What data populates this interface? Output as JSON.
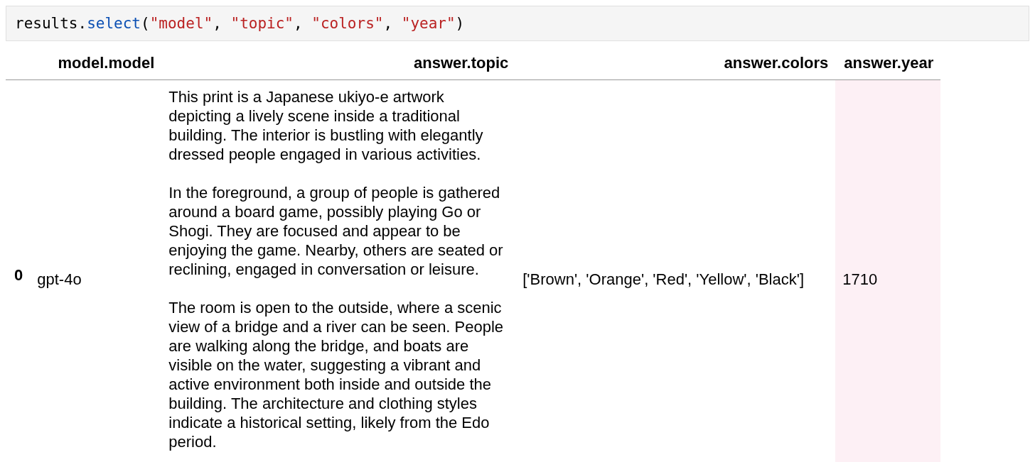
{
  "code_cell": {
    "tokens": [
      {
        "kind": "name",
        "text": "results."
      },
      {
        "kind": "method",
        "text": "select"
      },
      {
        "kind": "punct",
        "text": "("
      },
      {
        "kind": "string",
        "text": "\"model\""
      },
      {
        "kind": "punct",
        "text": ", "
      },
      {
        "kind": "string",
        "text": "\"topic\""
      },
      {
        "kind": "punct",
        "text": ", "
      },
      {
        "kind": "string",
        "text": "\"colors\""
      },
      {
        "kind": "punct",
        "text": ", "
      },
      {
        "kind": "string",
        "text": "\"year\""
      },
      {
        "kind": "punct",
        "text": ")"
      }
    ]
  },
  "table": {
    "columns": [
      {
        "label": "model.model",
        "highlighted": false
      },
      {
        "label": "answer.topic",
        "highlighted": false
      },
      {
        "label": "answer.colors",
        "highlighted": false
      },
      {
        "label": "answer.year",
        "highlighted": true
      }
    ],
    "rows": [
      {
        "index": "0",
        "cells": [
          [
            "gpt-4o"
          ],
          [
            "This print is a Japanese ukiyo-e artwork depicting a lively scene inside a traditional building. The interior is bustling with elegantly dressed people engaged in various activities.",
            "In the foreground, a group of people is gathered around a board game, possibly playing Go or Shogi. They are focused and appear to be enjoying the game. Nearby, others are seated or reclining, engaged in conversation or leisure.",
            "The room is open to the outside, where a scenic view of a bridge and a river can be seen. People are walking along the bridge, and boats are visible on the water, suggesting a vibrant and active environment both inside and outside the building. The architecture and clothing styles indicate a historical setting, likely from the Edo period."
          ],
          [
            "['Brown', 'Orange', 'Red', 'Yellow', 'Black']"
          ],
          [
            "1710"
          ]
        ]
      }
    ]
  }
}
